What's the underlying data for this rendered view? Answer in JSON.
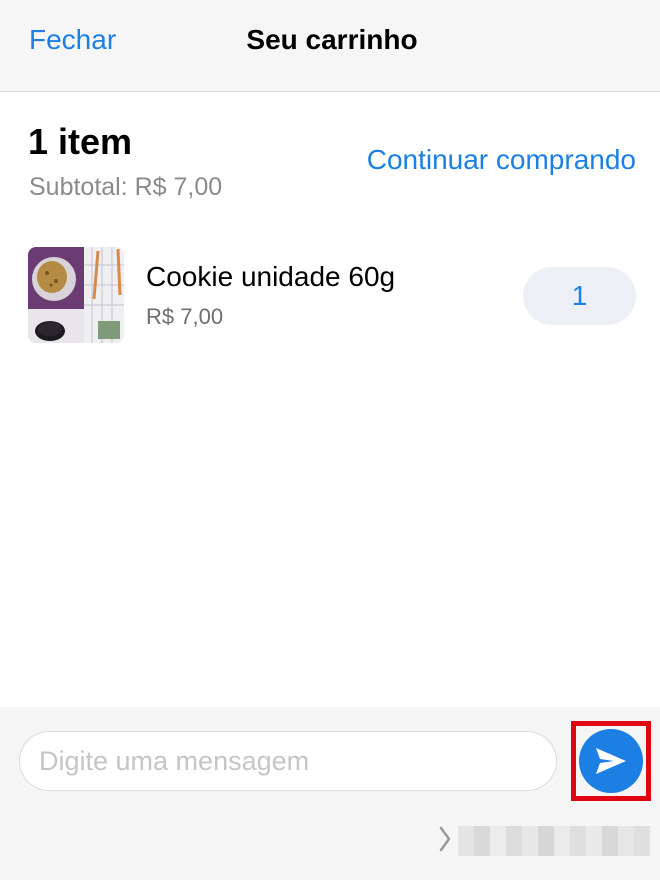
{
  "header": {
    "close_label": "Fechar",
    "title": "Seu carrinho"
  },
  "summary": {
    "item_count": "1 item",
    "subtotal": "Subtotal: R$ 7,00",
    "continue_label": "Continuar comprando"
  },
  "cart_items": [
    {
      "name": "Cookie unidade 60g",
      "price": "R$ 7,00",
      "quantity": "1",
      "thumbnail": "cookie-plate-photo"
    }
  ],
  "composer": {
    "placeholder": "Digite uma mensagem",
    "send_icon": "send-arrow-icon",
    "footer_icon": "chevron-right-icon"
  },
  "colors": {
    "accent": "#1b7fe3",
    "highlight": "#e20613",
    "header_bg": "#f6f6f6",
    "secondary_text": "#8a8a8a"
  }
}
